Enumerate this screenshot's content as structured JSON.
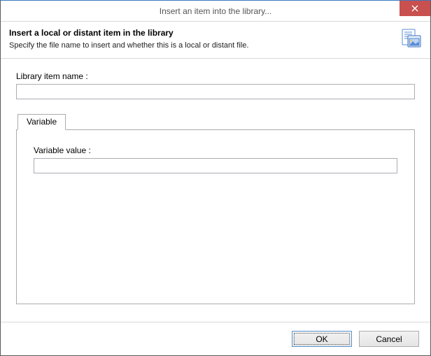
{
  "titlebar": {
    "title": "Insert an item into the library..."
  },
  "header": {
    "title": "Insert a local or distant item in the library",
    "subtitle": "Specify the file name to insert and whether this is a local or distant file."
  },
  "fields": {
    "library_item_label": "Library item name :",
    "library_item_value": ""
  },
  "tabs": {
    "variable": {
      "label": "Variable",
      "value_label": "Variable value :",
      "value": ""
    }
  },
  "buttons": {
    "ok": "OK",
    "cancel": "Cancel"
  }
}
